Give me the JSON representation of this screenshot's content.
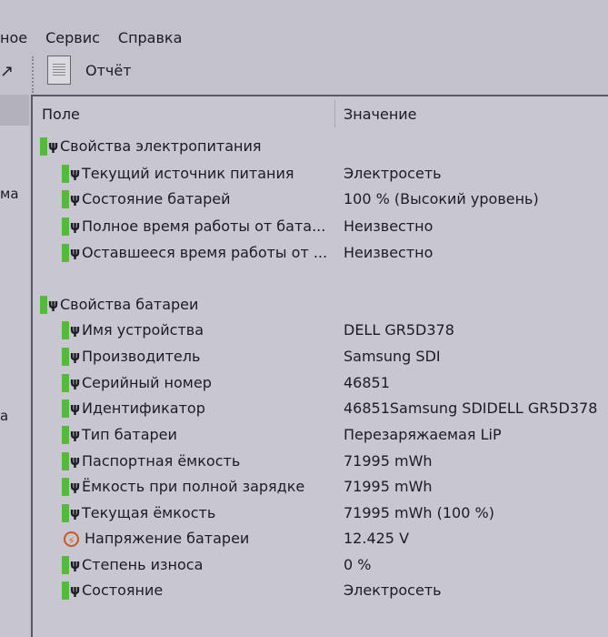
{
  "menu": [
    "ное",
    "Сервис",
    "Справка"
  ],
  "toolbar": {
    "report_label": "Отчёт"
  },
  "left_fragments": [
    "ма",
    "а"
  ],
  "columns": {
    "field": "Поле",
    "value": "Значение"
  },
  "groups": [
    {
      "title": "Свойства электропитания",
      "rows": [
        {
          "field": "Текущий источник питания",
          "value": "Электросеть",
          "icon": "battery-plug"
        },
        {
          "field": "Состояние батарей",
          "value": "100 % (Высокий уровень)",
          "icon": "battery-plug"
        },
        {
          "field": "Полное время работы от бата...",
          "value": "Неизвестно",
          "icon": "battery-plug"
        },
        {
          "field": "Оставшееся время работы от ...",
          "value": "Неизвестно",
          "icon": "battery-plug"
        }
      ]
    },
    {
      "title": "Свойства батареи",
      "rows": [
        {
          "field": "Имя устройства",
          "value": "DELL GR5D378",
          "icon": "battery-plug"
        },
        {
          "field": "Производитель",
          "value": "Samsung SDI",
          "icon": "battery-plug"
        },
        {
          "field": "Серийный номер",
          "value": "46851",
          "icon": "battery-plug"
        },
        {
          "field": "Идентификатор",
          "value": "46851Samsung SDIDELL GR5D378",
          "icon": "battery-plug"
        },
        {
          "field": "Тип батареи",
          "value": "Перезаряжаемая LiP",
          "icon": "battery-plug"
        },
        {
          "field": "Паспортная ёмкость",
          "value": "71995 mWh",
          "icon": "battery-plug"
        },
        {
          "field": "Ёмкость при полной зарядке",
          "value": "71995 mWh",
          "icon": "battery-plug"
        },
        {
          "field": "Текущая ёмкость",
          "value": "71995 mWh  (100 %)",
          "icon": "battery-plug"
        },
        {
          "field": "Напряжение батареи",
          "value": "12.425 V",
          "icon": "voltage"
        },
        {
          "field": "Степень износа",
          "value": "0 %",
          "icon": "battery-plug"
        },
        {
          "field": "Состояние",
          "value": "Электросеть",
          "icon": "battery-plug"
        }
      ]
    }
  ]
}
